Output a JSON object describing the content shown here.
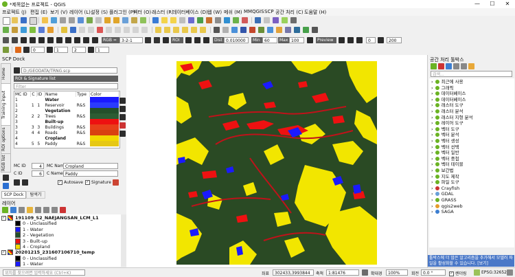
{
  "window": {
    "title": "*제목없는 프로젝트 - QGIS",
    "minimize": "—",
    "maximize": "☐",
    "close": "✕"
  },
  "menu": [
    "프로젝트 (J)",
    "편집 (E)",
    "보기 (V)",
    "레이어 (L)",
    "설정 (S)",
    "플러그인 (P)",
    "벡터 (O)",
    "래스터 (R)",
    "데이터베이스 (D)",
    "웹 (W)",
    "메쉬 (M)",
    "MMQGIS",
    "SCP",
    "공간 처리 (C)",
    "도움말 (H)"
  ],
  "scp_toolbar": {
    "rgb_label": "RGB =",
    "rgb_value": "3-2-1",
    "roi_label": "ROI",
    "dist_label": "Dist",
    "dist_value": "0.010000",
    "min_label": "Min",
    "min_value": "60",
    "max_label": "Max",
    "max_value": "100",
    "preview_label": "Preview",
    "field_a": "0",
    "field_b": "200"
  },
  "toolbar4": {
    "f1": "0",
    "f2": "1",
    "f3": "2",
    "f4": "1"
  },
  "scp_dock": {
    "title": "SCP Dock",
    "path": "D:/GEODATA/TRNG.scp",
    "roi_header": "ROI & Signature list",
    "filter_placeholder": "Filter",
    "columns": [
      "MC ID",
      "C",
      "ID",
      "Name",
      "Type",
      "Color"
    ],
    "side_tabs": [
      "Home",
      "Training input",
      "ROI options",
      "RGB list"
    ],
    "mc_id_label": "MC ID",
    "mc_id_value": "4",
    "mc_name_label": "MC Name",
    "mc_name_value": "Cropland",
    "c_id_label": "C ID",
    "c_id_value": "6",
    "c_name_label": "C Name",
    "c_name_value": "Paddy",
    "autosave_label": "Autosave",
    "signature_label": "Signature",
    "tab_scp": "SCP Dock",
    "tab_browser": "탐색기"
  },
  "roi_rows": [
    {
      "mc": "1",
      "c": "",
      "id": "",
      "name": "Water",
      "type": "",
      "color": "#1a1aff",
      "bold": true
    },
    {
      "mc": "1",
      "c": "1",
      "id": "1",
      "name": "Reservoir",
      "type": "R&S",
      "color": "#2b3bff",
      "bold": false
    },
    {
      "mc": "2",
      "c": "",
      "id": "",
      "name": "Vegetation",
      "type": "",
      "color": "#24502a",
      "bold": true
    },
    {
      "mc": "2",
      "c": "2",
      "id": "2",
      "name": "Trees",
      "type": "R&S",
      "color": "#2d5c33",
      "bold": false
    },
    {
      "mc": "3",
      "c": "",
      "id": "",
      "name": "Built-up",
      "type": "",
      "color": "#ee1111",
      "bold": true
    },
    {
      "mc": "3",
      "c": "3",
      "id": "3",
      "name": "Buildings",
      "type": "R&S",
      "color": "#e8401a",
      "bold": false
    },
    {
      "mc": "3",
      "c": "4",
      "id": "4",
      "name": "Roads",
      "type": "R&S",
      "color": "#d94010",
      "bold": false
    },
    {
      "mc": "4",
      "c": "",
      "id": "",
      "name": "Cropland",
      "type": "",
      "color": "#f2d800",
      "bold": true
    },
    {
      "mc": "4",
      "c": "5",
      "id": "5",
      "name": "Paddy",
      "type": "R&S",
      "color": "#e6c814",
      "bold": false
    }
  ],
  "layers": {
    "title": "레이어",
    "items": [
      {
        "kind": "layer",
        "label": "191109_S2_NAEJANGSAN_LCM_L1"
      },
      {
        "kind": "class",
        "label": "0 - Unclassified",
        "color": "#000000"
      },
      {
        "kind": "class",
        "label": "1 - Water",
        "color": "#1a1aff"
      },
      {
        "kind": "class",
        "label": "2 - Vegetation",
        "color": "#24502a"
      },
      {
        "kind": "class",
        "label": "3 - Built-up",
        "color": "#ee1111"
      },
      {
        "kind": "class",
        "label": "4 - Cropland",
        "color": "#f2d800"
      },
      {
        "kind": "layer",
        "label": "20201215_231607106710_temp"
      },
      {
        "kind": "class",
        "label": "0 - Unclassified",
        "color": "#000000"
      },
      {
        "kind": "class",
        "label": "1 - Water",
        "color": "#1a1aff"
      }
    ]
  },
  "processing": {
    "title": "공간 처리 툴박스",
    "search_placeholder": "검색...",
    "items": [
      "최근에 사용",
      "그래픽",
      "데이터베이스",
      "데이터베이스",
      "래스터 도구",
      "래스터 분석",
      "래스터 지형 분석",
      "레이어 도구",
      "벡터 도구",
      "벡터 분석",
      "벡터 생성",
      "벡터 선택",
      "벡터 일반",
      "벡터 중첩",
      "벡터 테이블",
      "보간법",
      "지도 제작",
      "파일 도구",
      "Crayfish",
      "GDAL",
      "GRASS",
      "qgis2web",
      "SAGA"
    ],
    "notice": "툴박스에 더 많은 알고리즘을 추가해서 모델러 파일을 활성화할 수 있습니다. [보기]"
  },
  "status": {
    "locator_placeholder": "위치를 찾으려면 입력하세요 (Ctrl+K)",
    "coord_label": "좌표",
    "coord_value": "302433,3993844",
    "scale_label": "축척",
    "scale_value": "1:81476",
    "magnifier_label": "확대경",
    "magnifier_value": "100%",
    "rotation_label": "회전",
    "rotation_value": "0.0 °",
    "render_label": "렌더링",
    "crs_label": "EPSG:32652"
  },
  "colors": {
    "water": "#1a1aff",
    "vegetation": "#2a4a24",
    "builtup": "#ee1111",
    "cropland": "#f2e600",
    "qgis_green": "#6bb324"
  }
}
